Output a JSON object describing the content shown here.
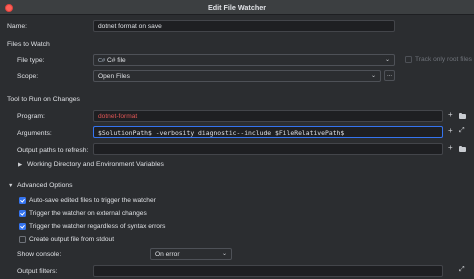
{
  "window": {
    "title": "Edit File Watcher"
  },
  "name": {
    "label": "Name:",
    "value": "dotnet format on save"
  },
  "files_to_watch": {
    "header": "Files to Watch",
    "file_type_label": "File type:",
    "file_type_icon": "C#",
    "file_type_value": "C# file",
    "track_only_root_label": "Track only root files",
    "scope_label": "Scope:",
    "scope_value": "Open Files",
    "scope_more": "..."
  },
  "tool": {
    "header": "Tool to Run on Changes",
    "program_label": "Program:",
    "program_value": "dotnet-format",
    "arguments_label": "Arguments:",
    "arguments_value": "$SolutionPath$ -verbosity diagnostic--include $FileRelativePath$",
    "output_paths_label": "Output paths to refresh:",
    "output_paths_value": "",
    "working_dir_label": "Working Directory and Environment Variables"
  },
  "advanced": {
    "header": "Advanced Options",
    "options": [
      {
        "label": "Auto-save edited files to trigger the watcher",
        "checked": true
      },
      {
        "label": "Trigger the watcher on external changes",
        "checked": true
      },
      {
        "label": "Trigger the watcher regardless of syntax errors",
        "checked": true
      },
      {
        "label": "Create output file from stdout",
        "checked": false
      }
    ],
    "show_console_label": "Show console:",
    "show_console_value": "On error",
    "output_filters_label": "Output filters:"
  },
  "colors": {
    "accent": "#3574f0",
    "program_text": "#e05555",
    "background": "#2b2d30"
  }
}
